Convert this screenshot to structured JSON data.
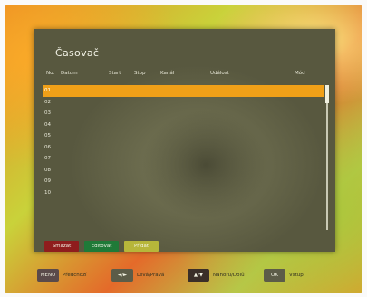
{
  "title": "Časovač",
  "columns": {
    "no": "No.",
    "date": "Datum",
    "start": "Start",
    "stop": "Stop",
    "channel": "Kanál",
    "event": "Událost",
    "mode": "Mód"
  },
  "rows": [
    "01",
    "02",
    "03",
    "04",
    "05",
    "06",
    "07",
    "08",
    "09",
    "10"
  ],
  "selected_row": "01",
  "buttons": {
    "delete": "Smazat",
    "edit": "Editovat",
    "add": "Přidat"
  },
  "footer": {
    "menu_key": "MENU",
    "menu_label": "Předchozí",
    "lr_key": "◄/►",
    "lr_label": "Levá/Pravá",
    "ud_key": "▲/▼",
    "ud_label": "Nahoru/Dolů",
    "ok_key": "OK",
    "ok_label": "Vstup"
  },
  "colors": {
    "highlight": "#f0a018",
    "red_button": "#8f1d1d",
    "green_button": "#1f7a38",
    "yellow_button": "#b7b63a"
  }
}
